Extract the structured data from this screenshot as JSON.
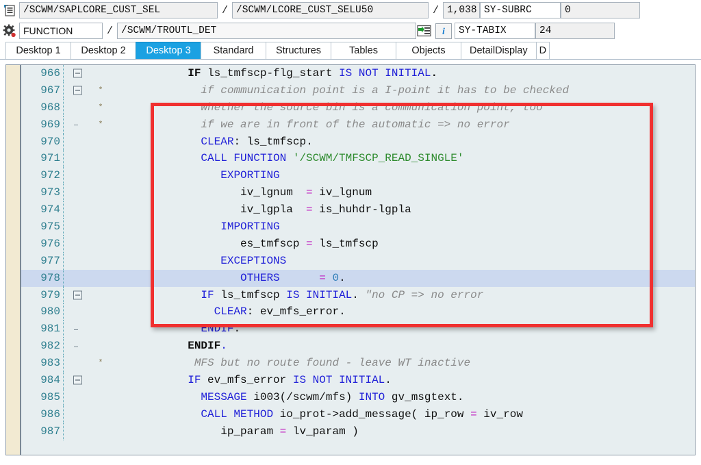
{
  "header": {
    "row1": {
      "program_icon": "program-icon",
      "program": "/SCWM/SAPLCORE_CUST_SEL",
      "sep1": "/",
      "include": "/SCWM/LCORE_CUST_SELU50",
      "sep2": "/",
      "line_number": "1,038",
      "sys_field_1_name": "SY-SUBRC",
      "sys_field_1_value": "0"
    },
    "row2": {
      "event_icon": "gear-icon",
      "event_kind": "FUNCTION",
      "sep1": "/",
      "event_name": "/SCWM/TROUTL_DET",
      "goto_icon": "goto-statement-icon",
      "info_icon": "info-icon",
      "sys_field_2_name": "SY-TABIX",
      "sys_field_2_value": "24"
    }
  },
  "tabs": [
    {
      "label": "Desktop 1",
      "active": false
    },
    {
      "label": "Desktop 2",
      "active": false
    },
    {
      "label": "Desktop 3",
      "active": true
    },
    {
      "label": "Standard",
      "active": false
    },
    {
      "label": "Structures",
      "active": false
    },
    {
      "label": "Tables",
      "active": false
    },
    {
      "label": "Objects",
      "active": false
    },
    {
      "label": "DetailDisplay",
      "active": false
    },
    {
      "label": "D",
      "active": false
    }
  ],
  "editor": {
    "current_line": 978,
    "lines": [
      {
        "num": "966",
        "fold": "box",
        "mark": "",
        "indent": 12,
        "tokens": [
          {
            "t": "IF ",
            "c": "kwb"
          },
          {
            "t": "ls_tmfscp-flg_start ",
            "c": "idn"
          },
          {
            "t": "IS NOT INITIAL",
            "c": "kw"
          },
          {
            "t": ".",
            "c": "kwb"
          }
        ]
      },
      {
        "num": "967",
        "fold": "box",
        "mark": "*",
        "indent": 14,
        "tokens": [
          {
            "t": "if communication point is a I-point it has to be checked",
            "c": "cmt"
          }
        ]
      },
      {
        "num": "968",
        "fold": "none",
        "mark": "*",
        "indent": 14,
        "tokens": [
          {
            "t": "whether the source bin is a communication point, too",
            "c": "cmt"
          }
        ]
      },
      {
        "num": "969",
        "fold": "tick",
        "mark": "*",
        "indent": 14,
        "tokens": [
          {
            "t": "if we are in front of the automatic => no error",
            "c": "cmt"
          }
        ]
      },
      {
        "num": "970",
        "fold": "none",
        "mark": "",
        "indent": 14,
        "tokens": [
          {
            "t": "CLEAR",
            "c": "kw"
          },
          {
            "t": ": ",
            "c": "idn"
          },
          {
            "t": "ls_tmfscp",
            "c": "idn"
          },
          {
            "t": ".",
            "c": "idn"
          }
        ]
      },
      {
        "num": "971",
        "fold": "none",
        "mark": "",
        "indent": 14,
        "tokens": [
          {
            "t": "CALL FUNCTION ",
            "c": "kw"
          },
          {
            "t": "'/SCWM/TMFSCP_READ_SINGLE'",
            "c": "str"
          }
        ]
      },
      {
        "num": "972",
        "fold": "none",
        "mark": "",
        "indent": 17,
        "tokens": [
          {
            "t": "EXPORTING",
            "c": "kw"
          }
        ]
      },
      {
        "num": "973",
        "fold": "none",
        "mark": "",
        "indent": 20,
        "tokens": [
          {
            "t": "iv_lgnum  ",
            "c": "idn"
          },
          {
            "t": "=",
            "c": "op"
          },
          {
            "t": " iv_lgnum",
            "c": "idn"
          }
        ]
      },
      {
        "num": "974",
        "fold": "none",
        "mark": "",
        "indent": 20,
        "tokens": [
          {
            "t": "iv_lgpla  ",
            "c": "idn"
          },
          {
            "t": "=",
            "c": "op"
          },
          {
            "t": " is_huhdr-lgpla",
            "c": "idn"
          }
        ]
      },
      {
        "num": "975",
        "fold": "none",
        "mark": "",
        "indent": 17,
        "tokens": [
          {
            "t": "IMPORTING",
            "c": "kw"
          }
        ]
      },
      {
        "num": "976",
        "fold": "none",
        "mark": "",
        "indent": 20,
        "tokens": [
          {
            "t": "es_tmfscp ",
            "c": "idn"
          },
          {
            "t": "=",
            "c": "op"
          },
          {
            "t": " ls_tmfscp",
            "c": "idn"
          }
        ]
      },
      {
        "num": "977",
        "fold": "none",
        "mark": "",
        "indent": 17,
        "tokens": [
          {
            "t": "EXCEPTIONS",
            "c": "kw"
          }
        ]
      },
      {
        "num": "978",
        "fold": "none",
        "mark": "",
        "indent": 20,
        "tokens": [
          {
            "t": "OTHERS",
            "c": "kw"
          },
          {
            "t": "      ",
            "c": "idn"
          },
          {
            "t": "=",
            "c": "op"
          },
          {
            "t": " ",
            "c": "idn"
          },
          {
            "t": "0",
            "c": "num"
          },
          {
            "t": ".",
            "c": "idn"
          }
        ]
      },
      {
        "num": "979",
        "fold": "box",
        "mark": "",
        "indent": 14,
        "tokens": [
          {
            "t": "IF ",
            "c": "kw"
          },
          {
            "t": "ls_tmfscp ",
            "c": "idn"
          },
          {
            "t": "IS INITIAL",
            "c": "kw"
          },
          {
            "t": ". ",
            "c": "idn"
          },
          {
            "t": "\"no CP => no error",
            "c": "cmt"
          }
        ]
      },
      {
        "num": "980",
        "fold": "none",
        "mark": "",
        "indent": 16,
        "tokens": [
          {
            "t": "CLEAR",
            "c": "kw"
          },
          {
            "t": ": ev_mfs_error.",
            "c": "idn"
          }
        ]
      },
      {
        "num": "981",
        "fold": "tick",
        "mark": "",
        "indent": 14,
        "tokens": [
          {
            "t": "ENDIF",
            "c": "kw"
          },
          {
            "t": ".",
            "c": "idn"
          }
        ]
      },
      {
        "num": "982",
        "fold": "tick",
        "mark": "",
        "indent": 12,
        "tokens": [
          {
            "t": "ENDIF",
            "c": "kwb"
          },
          {
            "t": ".",
            "c": "kw"
          }
        ]
      },
      {
        "num": "983",
        "fold": "none",
        "mark": "*",
        "indent": 13,
        "tokens": [
          {
            "t": "MFS but no route found - leave WT inactive",
            "c": "cmt"
          }
        ]
      },
      {
        "num": "984",
        "fold": "box",
        "mark": "",
        "indent": 12,
        "tokens": [
          {
            "t": "IF ",
            "c": "kw"
          },
          {
            "t": "ev_mfs_error ",
            "c": "idn"
          },
          {
            "t": "IS NOT INITIAL",
            "c": "kw"
          },
          {
            "t": ".",
            "c": "idn"
          }
        ]
      },
      {
        "num": "985",
        "fold": "none",
        "mark": "",
        "indent": 14,
        "tokens": [
          {
            "t": "MESSAGE",
            "c": "kw"
          },
          {
            "t": " i003(/scwm/mfs) ",
            "c": "idn"
          },
          {
            "t": "INTO",
            "c": "kw"
          },
          {
            "t": " gv_msgtext.",
            "c": "idn"
          }
        ]
      },
      {
        "num": "986",
        "fold": "none",
        "mark": "",
        "indent": 14,
        "tokens": [
          {
            "t": "CALL METHOD",
            "c": "kw"
          },
          {
            "t": " io_prot->add_message( ip_row ",
            "c": "idn"
          },
          {
            "t": "=",
            "c": "op"
          },
          {
            "t": " iv_row",
            "c": "idn"
          }
        ]
      },
      {
        "num": "987",
        "fold": "none",
        "mark": "",
        "indent": 17,
        "tokens": [
          {
            "t": "ip_param ",
            "c": "idn"
          },
          {
            "t": "=",
            "c": "op"
          },
          {
            "t": " lv_param )",
            "c": "idn"
          }
        ]
      }
    ]
  },
  "annotation": {
    "highlight_box": "red-rectangle-annotation",
    "color": "#f03030"
  }
}
